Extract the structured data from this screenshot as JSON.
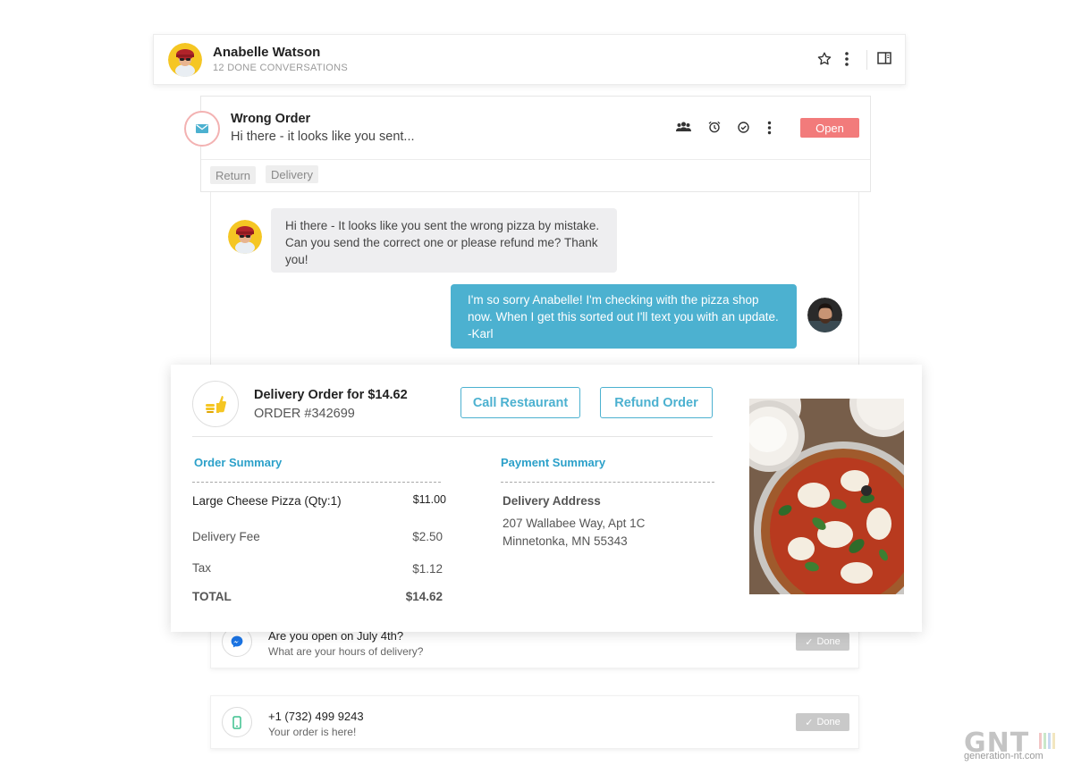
{
  "header": {
    "contact_name": "Anabelle Watson",
    "done_conversations": "12 DONE CONVERSATIONS"
  },
  "conversation": {
    "subject": "Wrong Order",
    "preview": "Hi there - it looks like you sent...",
    "status": "Open",
    "tags": [
      "Return",
      "Delivery"
    ]
  },
  "messages": [
    {
      "from": "customer",
      "text": "Hi there - It looks like you sent the wrong pizza by mistake. Can you send the correct one or please refund me? Thank you!"
    },
    {
      "from": "agent",
      "text": "I'm so sorry Anabelle! I'm checking with the pizza shop now. When I get this sorted out I'll text you with an update. -Karl"
    }
  ],
  "order": {
    "title": "Delivery Order for $14.62",
    "number": "ORDER #342699",
    "call_label": "Call Restaurant",
    "refund_label": "Refund Order",
    "order_summary_title": "Order Summary",
    "payment_summary_title": "Payment Summary",
    "items": [
      {
        "label": "Large Cheese Pizza (Qty:1)",
        "value": "$11.00"
      },
      {
        "label": "Delivery Fee",
        "value": "$2.50"
      },
      {
        "label": "Tax",
        "value": "$1.12"
      }
    ],
    "total_label": "TOTAL",
    "total_value": "$14.62",
    "address_label": "Delivery Address",
    "address_line1": "207 Wallabee Way, Apt 1C",
    "address_line2": "Minnetonka, MN 55343"
  },
  "tickets": [
    {
      "channel": "messenger",
      "title": "Are you open on July 4th?",
      "subtitle": "What are your hours of delivery?",
      "done_label": "Done"
    },
    {
      "channel": "sms",
      "title": "+1 (732) 499 9243",
      "subtitle": "Your order is here!",
      "done_label": "Done"
    }
  ],
  "watermark": {
    "logo": "GNT",
    "url": "generation-nt.com"
  },
  "colors": {
    "accent": "#4cb1d0",
    "open_badge": "#f27b7b",
    "section_title": "#2ba0c9",
    "done_badge": "#c9c9c9"
  }
}
